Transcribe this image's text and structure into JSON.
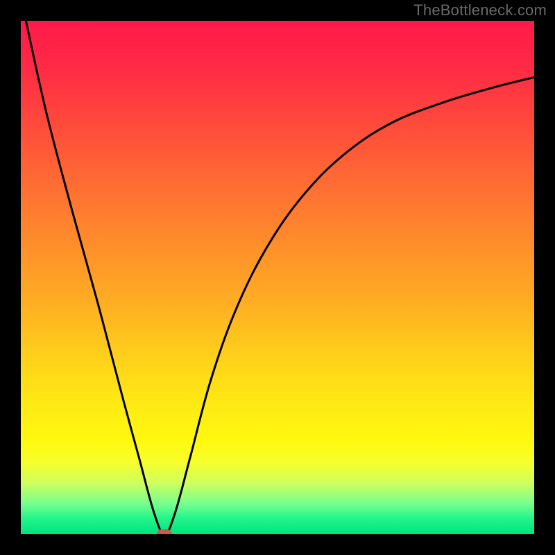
{
  "watermark": "TheBottleneck.com",
  "chart_data": {
    "type": "line",
    "title": "",
    "xlabel": "",
    "ylabel": "",
    "xlim": [
      0,
      100
    ],
    "ylim": [
      0,
      100
    ],
    "grid": false,
    "legend": false,
    "background": "red-yellow-green vertical gradient",
    "series": [
      {
        "name": "curve",
        "x": [
          1,
          5,
          10,
          15,
          20,
          23,
          26,
          28,
          30,
          33,
          37,
          42,
          48,
          55,
          63,
          72,
          82,
          92,
          100
        ],
        "y": [
          100,
          82,
          63,
          45,
          26,
          15,
          4,
          0,
          4,
          15,
          30,
          44,
          56,
          66,
          74,
          80,
          84,
          87,
          89
        ]
      }
    ],
    "marker": {
      "x": 28,
      "y": 0,
      "color": "#ca5a55"
    },
    "gradient_stops": [
      {
        "pct": 0,
        "color": "#ff1a4a"
      },
      {
        "pct": 50,
        "color": "#ffa126"
      },
      {
        "pct": 82,
        "color": "#fff90f"
      },
      {
        "pct": 100,
        "color": "#00e37e"
      }
    ]
  }
}
